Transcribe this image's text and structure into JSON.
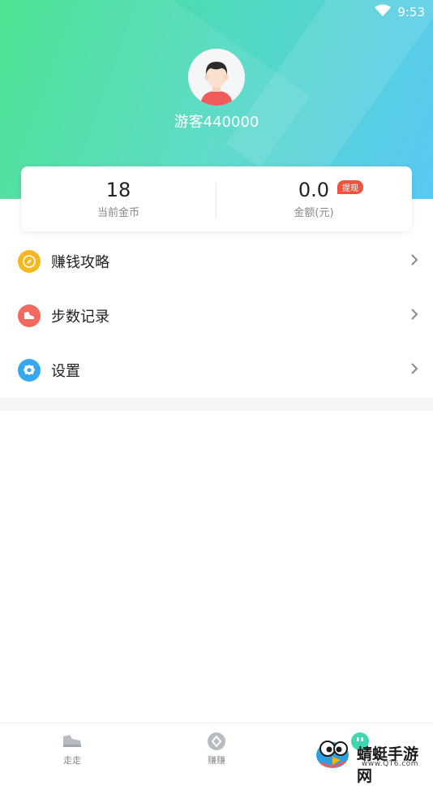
{
  "status_bar": {
    "time": "9:53",
    "wifi_icon": "wifi-icon"
  },
  "colors": {
    "header_start": "#3fe08a",
    "header_end": "#5ac8f5",
    "badge": "#f0533f",
    "icon_strategy": "#f5b820",
    "icon_steps": "#f26a5d",
    "icon_settings": "#36a8f0"
  },
  "profile": {
    "username": "游客440000",
    "avatar_icon": "avatar-icon"
  },
  "stats": {
    "coins": {
      "value": "18",
      "label": "当前金币"
    },
    "money": {
      "value": "0.0",
      "label": "金额(元)",
      "badge": "提现"
    }
  },
  "menu": [
    {
      "label": "赚钱攻略",
      "icon": "compass-icon"
    },
    {
      "label": "步数记录",
      "icon": "shoe-icon"
    },
    {
      "label": "设置",
      "icon": "gear-icon"
    }
  ],
  "bottom_nav": [
    {
      "label": "走走",
      "icon": "sneaker-icon"
    },
    {
      "label": "赚赚",
      "icon": "coin-icon"
    },
    {
      "label": "",
      "icon": "profile-icon"
    }
  ],
  "watermark": {
    "title": "蜻蜓手游网",
    "url": "www.QT6.com"
  }
}
